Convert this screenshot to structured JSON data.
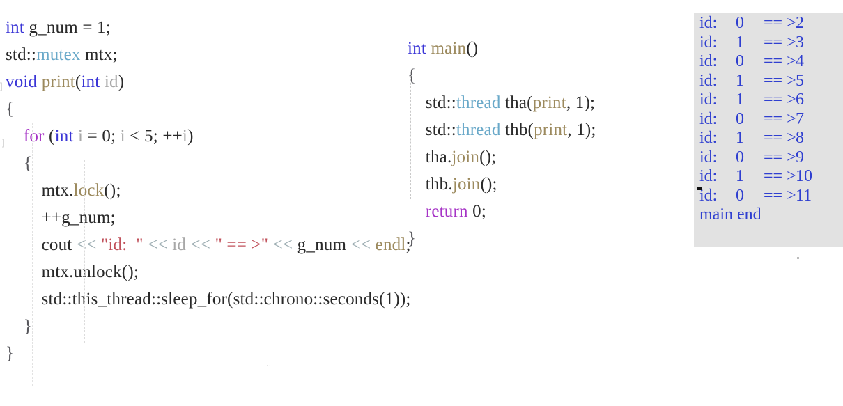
{
  "editor": {
    "left_block": {
      "lines": [
        [
          {
            "t": "int",
            "c": "kw-blue"
          },
          {
            "t": " g_num = 1;",
            "c": "plain"
          }
        ],
        [
          {
            "t": "std::",
            "c": "plain"
          },
          {
            "t": "mutex",
            "c": "type-cyan"
          },
          {
            "t": " mtx;",
            "c": "plain"
          }
        ],
        [
          {
            "t": "void",
            "c": "kw-blue"
          },
          {
            "t": " ",
            "c": "plain"
          },
          {
            "t": "print",
            "c": "fn-tan"
          },
          {
            "t": "(",
            "c": "plain"
          },
          {
            "t": "int",
            "c": "kw-blue"
          },
          {
            "t": " ",
            "c": "plain"
          },
          {
            "t": "id",
            "c": "param-gray"
          },
          {
            "t": ")",
            "c": "plain"
          }
        ],
        [
          {
            "t": "{",
            "c": "brace"
          }
        ],
        [
          {
            "t": "    ",
            "c": "plain"
          },
          {
            "t": "for",
            "c": "kw-purple"
          },
          {
            "t": " (",
            "c": "plain"
          },
          {
            "t": "int",
            "c": "kw-blue"
          },
          {
            "t": " ",
            "c": "plain"
          },
          {
            "t": "i",
            "c": "param-gray"
          },
          {
            "t": " = 0; ",
            "c": "plain"
          },
          {
            "t": "i",
            "c": "param-gray"
          },
          {
            "t": " < 5; ++",
            "c": "plain"
          },
          {
            "t": "i",
            "c": "param-gray"
          },
          {
            "t": ")",
            "c": "plain"
          }
        ],
        [
          {
            "t": "    ",
            "c": "plain"
          },
          {
            "t": "{",
            "c": "brace"
          }
        ],
        [
          {
            "t": "        mtx.",
            "c": "plain"
          },
          {
            "t": "lock",
            "c": "fn-tan"
          },
          {
            "t": "();",
            "c": "plain"
          }
        ],
        [
          {
            "t": "        ++g_num;",
            "c": "plain"
          }
        ],
        [
          {
            "t": "        cout ",
            "c": "plain"
          },
          {
            "t": "<<",
            "c": "op-gray"
          },
          {
            "t": " ",
            "c": "plain"
          },
          {
            "t": "\"id:  \"",
            "c": "str-red"
          },
          {
            "t": " ",
            "c": "plain"
          },
          {
            "t": "<<",
            "c": "op-gray"
          },
          {
            "t": " ",
            "c": "plain"
          },
          {
            "t": "id",
            "c": "param-gray"
          },
          {
            "t": " ",
            "c": "plain"
          },
          {
            "t": "<<",
            "c": "op-gray"
          },
          {
            "t": " ",
            "c": "plain"
          },
          {
            "t": "\" == >\"",
            "c": "str-red"
          },
          {
            "t": " ",
            "c": "plain"
          },
          {
            "t": "<<",
            "c": "op-gray"
          },
          {
            "t": " g_num ",
            "c": "plain"
          },
          {
            "t": "<<",
            "c": "op-gray"
          },
          {
            "t": " ",
            "c": "plain"
          },
          {
            "t": "endl",
            "c": "fn-tan"
          },
          {
            "t": ";",
            "c": "plain"
          }
        ],
        [
          {
            "t": "        mtx.",
            "c": "plain"
          },
          {
            "t": "unlock",
            "c": "plain"
          },
          {
            "t": "();",
            "c": "plain"
          }
        ],
        [
          {
            "t": "        std::this_thread::sleep_for(std::chrono::seconds(1));",
            "c": "plain"
          }
        ],
        [
          {
            "t": "    ",
            "c": "plain"
          },
          {
            "t": "}",
            "c": "brace"
          }
        ],
        [
          {
            "t": "}",
            "c": "brace"
          }
        ]
      ]
    },
    "main_block": {
      "lines": [
        [
          {
            "t": "int",
            "c": "kw-blue"
          },
          {
            "t": " ",
            "c": "plain"
          },
          {
            "t": "main",
            "c": "fn-tan"
          },
          {
            "t": "()",
            "c": "plain"
          }
        ],
        [
          {
            "t": "{",
            "c": "brace"
          }
        ],
        [
          {
            "t": "    std::",
            "c": "plain"
          },
          {
            "t": "thread",
            "c": "type-cyan"
          },
          {
            "t": " tha(",
            "c": "plain"
          },
          {
            "t": "print",
            "c": "fn-tan"
          },
          {
            "t": ", 1);",
            "c": "plain"
          }
        ],
        [
          {
            "t": "    std::",
            "c": "plain"
          },
          {
            "t": "thread",
            "c": "type-cyan"
          },
          {
            "t": " thb(",
            "c": "plain"
          },
          {
            "t": "print",
            "c": "fn-tan"
          },
          {
            "t": ", 1);",
            "c": "plain"
          }
        ],
        [
          {
            "t": "    tha.",
            "c": "plain"
          },
          {
            "t": "join",
            "c": "fn-tan"
          },
          {
            "t": "();",
            "c": "plain"
          }
        ],
        [
          {
            "t": "    thb.",
            "c": "plain"
          },
          {
            "t": "join",
            "c": "fn-tan"
          },
          {
            "t": "();",
            "c": "plain"
          }
        ],
        [
          {
            "t": "    ",
            "c": "plain"
          },
          {
            "t": "return",
            "c": "kw-purple"
          },
          {
            "t": " 0;",
            "c": "plain"
          }
        ],
        [
          {
            "t": "}",
            "c": "brace"
          }
        ]
      ]
    },
    "margin_artifacts": [
      "]",
      "]",
      "·",
      "··"
    ]
  },
  "console": {
    "background_color": "#e2e2e2",
    "text_color": "#2f3fd0",
    "lines": [
      {
        "label": "id:",
        "id": "0",
        "arrow": "== >",
        "value": "2"
      },
      {
        "label": "id:",
        "id": "1",
        "arrow": "== >",
        "value": "3"
      },
      {
        "label": "id:",
        "id": "0",
        "arrow": "== >",
        "value": "4"
      },
      {
        "label": "id:",
        "id": "1",
        "arrow": "== >",
        "value": "5"
      },
      {
        "label": "id:",
        "id": "1",
        "arrow": "== >",
        "value": "6"
      },
      {
        "label": "id:",
        "id": "0",
        "arrow": "== >",
        "value": "7"
      },
      {
        "label": "id:",
        "id": "1",
        "arrow": "== >",
        "value": "8"
      },
      {
        "label": "id:",
        "id": "0",
        "arrow": "== >",
        "value": "9"
      },
      {
        "label": "id:",
        "id": "1",
        "arrow": "== >",
        "value": "10"
      },
      {
        "label": "id:",
        "id": "0",
        "arrow": "== >",
        "value": "11"
      },
      {
        "label": "main end",
        "id": "",
        "arrow": "",
        "value": ""
      }
    ]
  }
}
